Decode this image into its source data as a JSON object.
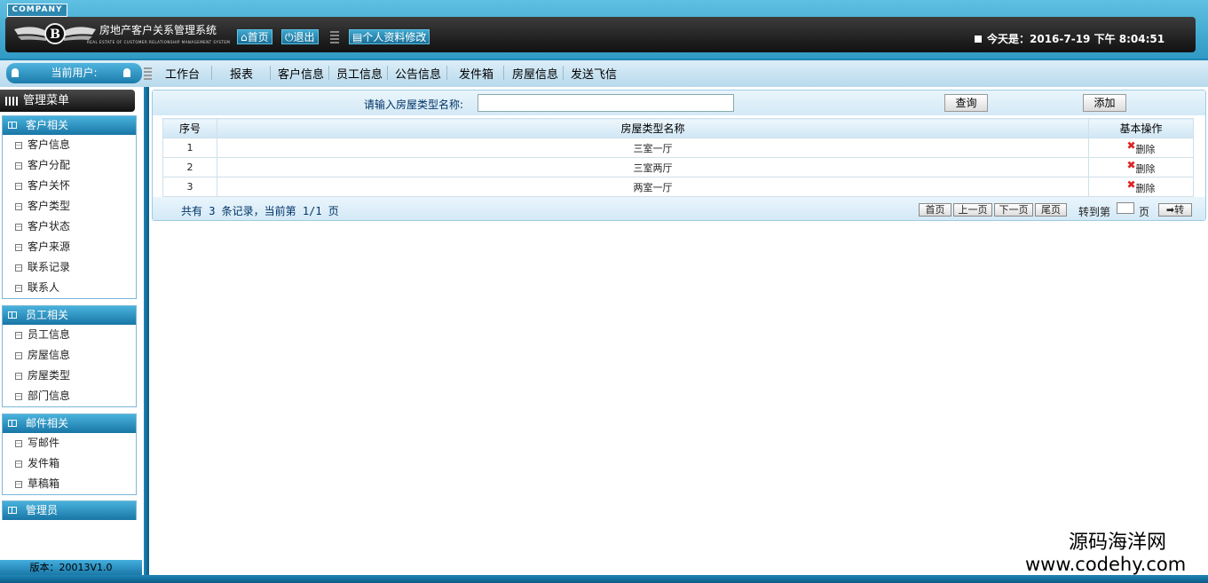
{
  "header": {
    "company_badge": "COMPANY",
    "system_name": "房地产客户关系管理系统",
    "system_name_en": "REAL ESTATE OF CUSTOMER RELATIONSHIP MANAGEMENT SYSTEM",
    "logo_letter": "B",
    "home_label": "首页",
    "logout_label": "退出",
    "profile_label": "个人资料修改",
    "date_text": "今天是：2016-7-19 下午 8:04:51"
  },
  "navbar": {
    "current_user_label": "当前用户:",
    "items": [
      "工作台",
      "报表",
      "客户信息",
      "员工信息",
      "公告信息",
      "发件箱",
      "房屋信息",
      "发送飞信"
    ]
  },
  "sidebar": {
    "title": "管理菜单",
    "groups": [
      {
        "title": "客户相关",
        "items": [
          "客户信息",
          "客户分配",
          "客户关怀",
          "客户类型",
          "客户状态",
          "客户来源",
          "联系记录",
          "联系人"
        ]
      },
      {
        "title": "员工相关",
        "items": [
          "员工信息",
          "房屋信息",
          "房屋类型",
          "部门信息"
        ]
      },
      {
        "title": "邮件相关",
        "items": [
          "写邮件",
          "发件箱",
          "草稿箱"
        ]
      },
      {
        "title": "管理员",
        "items": []
      }
    ],
    "version": "版本：20013V1.0"
  },
  "search": {
    "label": "请输入房屋类型名称:",
    "value": "",
    "query_button": "查询",
    "add_button": "添加"
  },
  "table": {
    "headers": [
      "序号",
      "房屋类型名称",
      "基本操作"
    ],
    "rows": [
      {
        "no": "1",
        "name": "三室一厅",
        "action": "删除"
      },
      {
        "no": "2",
        "name": "三室两厅",
        "action": "删除"
      },
      {
        "no": "3",
        "name": "两室一厅",
        "action": "删除"
      }
    ]
  },
  "pagination": {
    "record_info": "共有 3 条记录，当前第 1/1 页",
    "first": "首页",
    "prev": "上一页",
    "next": "下一页",
    "last": "尾页",
    "goto_label": "转到第",
    "goto_value": "",
    "page_label": "页",
    "go_button": "➡转"
  },
  "watermark": {
    "line1": "源码海洋网",
    "line2": "www.codehy.com"
  }
}
